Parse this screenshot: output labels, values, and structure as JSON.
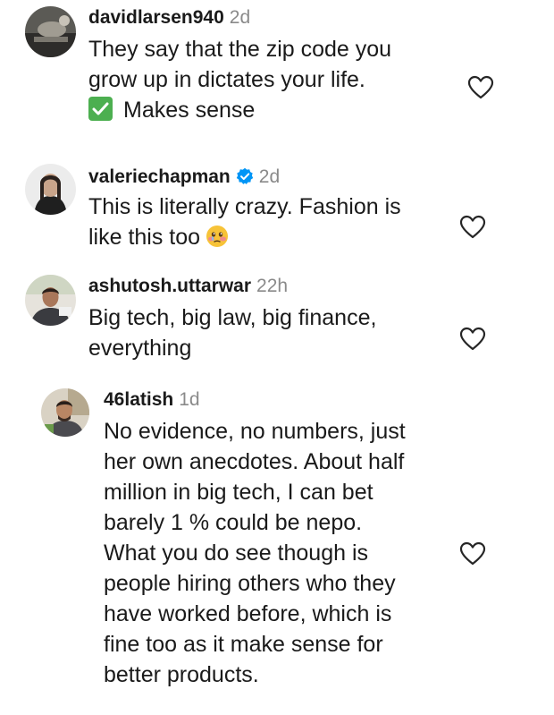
{
  "comments": [
    {
      "username": "davidlarsen940",
      "time": "2d",
      "verified": false,
      "lines": [
        "They say that the zip code you",
        "grow up in dictates your life.",
        "Makes sense"
      ],
      "emoji": "check-mark-emoji",
      "liked": false
    },
    {
      "username": "valeriechapman",
      "time": "2d",
      "verified": true,
      "lines": [
        "This is literally crazy. Fashion is",
        "like this too"
      ],
      "emoji": "face-holding-back-tears-emoji",
      "liked": false
    },
    {
      "username": "ashutosh.uttarwar",
      "time": "22h",
      "verified": false,
      "lines": [
        "Big tech, big law, big finance,",
        "everything"
      ],
      "liked": false
    },
    {
      "username": "46latish",
      "time": "1d",
      "verified": false,
      "is_reply": true,
      "lines": [
        "No evidence, no numbers, just",
        "her own anecdotes. About half",
        "million in big tech, I can bet",
        "barely 1 % could be nepo.",
        "What you do see though is",
        "people hiring others who they",
        "have worked before, which is",
        "fine too as it make sense for",
        "better products."
      ],
      "liked": false
    }
  ],
  "colors": {
    "text": "#1a1a1a",
    "meta": "#8a8a8a",
    "verified": "#0095f6",
    "check_emoji": "#4caf50"
  },
  "icons": {
    "like": "heart-outline-icon",
    "verified": "verified-badge-icon"
  }
}
